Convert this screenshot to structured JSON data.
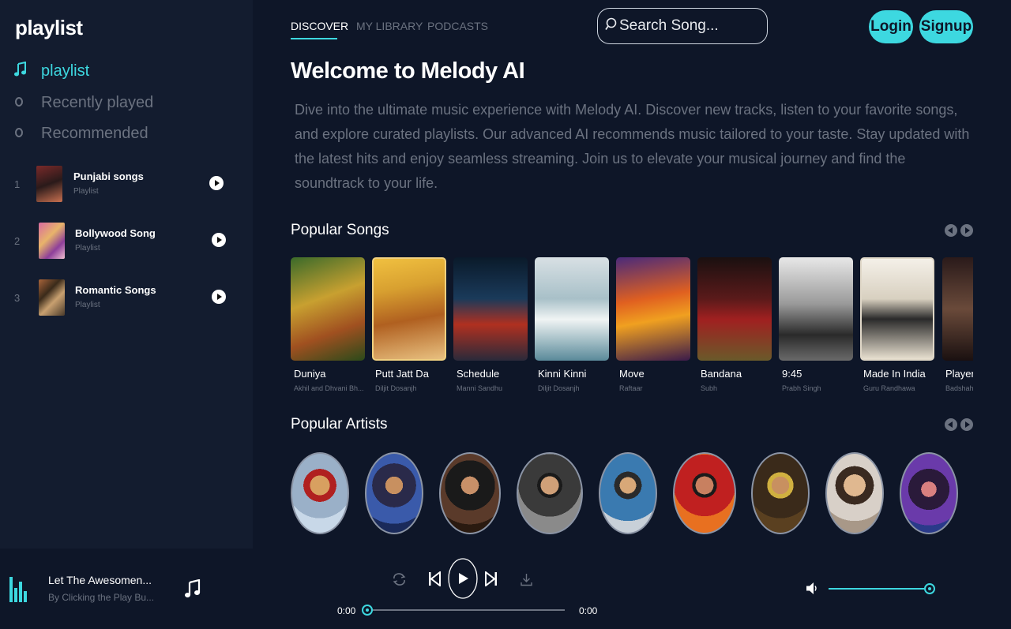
{
  "sidebar": {
    "brand": "playlist",
    "nav": [
      {
        "label": "playlist",
        "icon": "music-note-icon",
        "active": true
      },
      {
        "label": "Recently played",
        "icon": "circle-icon",
        "active": false
      },
      {
        "label": "Recommended",
        "icon": "circle-icon",
        "active": false
      }
    ],
    "playlists": [
      {
        "num": "1",
        "title": "Punjabi songs",
        "sub": "Playlist"
      },
      {
        "num": "2",
        "title": "Bollywood Song",
        "sub": "Playlist"
      },
      {
        "num": "3",
        "title": "Romantic Songs",
        "sub": "Playlist"
      }
    ]
  },
  "header": {
    "tabs": [
      "DISCOVER",
      "MY LIBRARY",
      "PODCASTS"
    ],
    "search_placeholder": "Search Song...",
    "login": "Login",
    "signup": "Signup"
  },
  "main": {
    "welcome": "Welcome to Melody AI",
    "description": "Dive into the ultimate music experience with Melody AI. Discover new tracks, listen to your favorite songs, and explore curated playlists. Our advanced AI recommends music tailored to your taste. Stay updated with the latest hits and enjoy seamless streaming. Join us to elevate your musical journey and find the soundtrack to your life.",
    "popular_songs_title": "Popular Songs",
    "popular_artists_title": "Popular Artists",
    "songs": [
      {
        "name": "Duniya",
        "artist": "Akhil and Dhvani Bh..."
      },
      {
        "name": "Putt Jatt Da",
        "artist": "Diljit Dosanjh"
      },
      {
        "name": "Schedule",
        "artist": "Manni Sandhu"
      },
      {
        "name": "Kinni Kinni",
        "artist": "Diljit Dosanjh"
      },
      {
        "name": "Move",
        "artist": "Raftaar"
      },
      {
        "name": "Bandana",
        "artist": "Subh"
      },
      {
        "name": "9:45",
        "artist": "Prabh Singh"
      },
      {
        "name": "Made In India",
        "artist": "Guru Randhawa"
      },
      {
        "name": "Players",
        "artist": "Badshah"
      }
    ]
  },
  "player": {
    "now_playing_title": "Let The Awesomen...",
    "now_playing_sub": "By Clicking the Play Bu...",
    "time_current": "0:00",
    "time_total": "0:00",
    "progress": 0,
    "volume": 1.0
  },
  "colors": {
    "accent": "#3dd8e0",
    "background": "#0e1628",
    "sidebar": "#131c2f",
    "muted": "#6b7280"
  }
}
